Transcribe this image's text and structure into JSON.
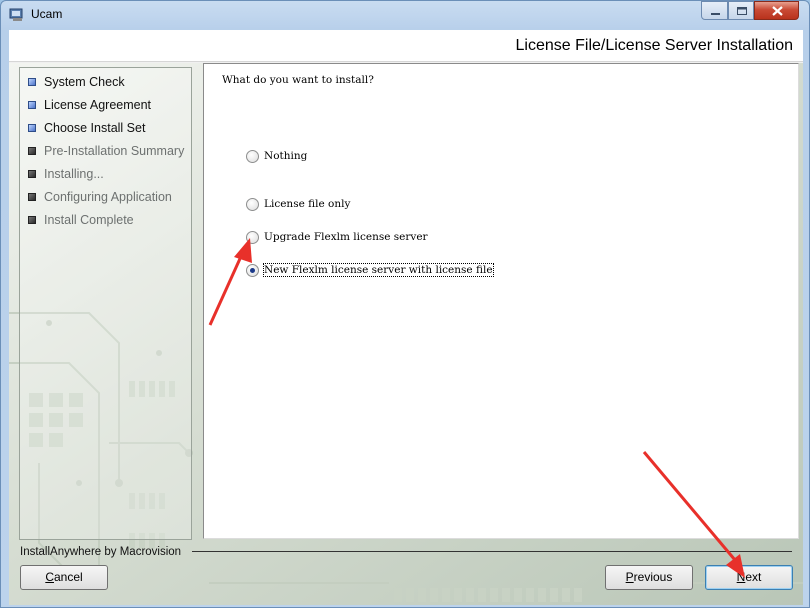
{
  "window": {
    "title": "Ucam"
  },
  "header": {
    "page_title": "License File/License Server Installation"
  },
  "steps": [
    {
      "label": "System Check",
      "state": "done"
    },
    {
      "label": "License Agreement",
      "state": "done"
    },
    {
      "label": "Choose Install Set",
      "state": "done"
    },
    {
      "label": "Pre-Installation Summary",
      "state": "pending"
    },
    {
      "label": "Installing...",
      "state": "pending"
    },
    {
      "label": "Configuring Application",
      "state": "pending"
    },
    {
      "label": "Install Complete",
      "state": "pending"
    }
  ],
  "main": {
    "question": "What do you want to install?",
    "options": [
      {
        "label": "Nothing",
        "selected": false
      },
      {
        "label": "License file only",
        "selected": false
      },
      {
        "label": "Upgrade Flexlm license server",
        "selected": false
      },
      {
        "label": "New Flexlm license server with license file",
        "selected": true
      }
    ]
  },
  "footer": {
    "brand": "InstallAnywhere by Macrovision",
    "cancel_first": "C",
    "cancel_rest": "ancel",
    "previous_first": "P",
    "previous_rest": "revious",
    "next_first": "N",
    "next_rest": "ext"
  },
  "colors": {
    "annotation_arrow": "#e8302a",
    "step_done": "#4d74c9",
    "close_button": "#c94a35"
  }
}
